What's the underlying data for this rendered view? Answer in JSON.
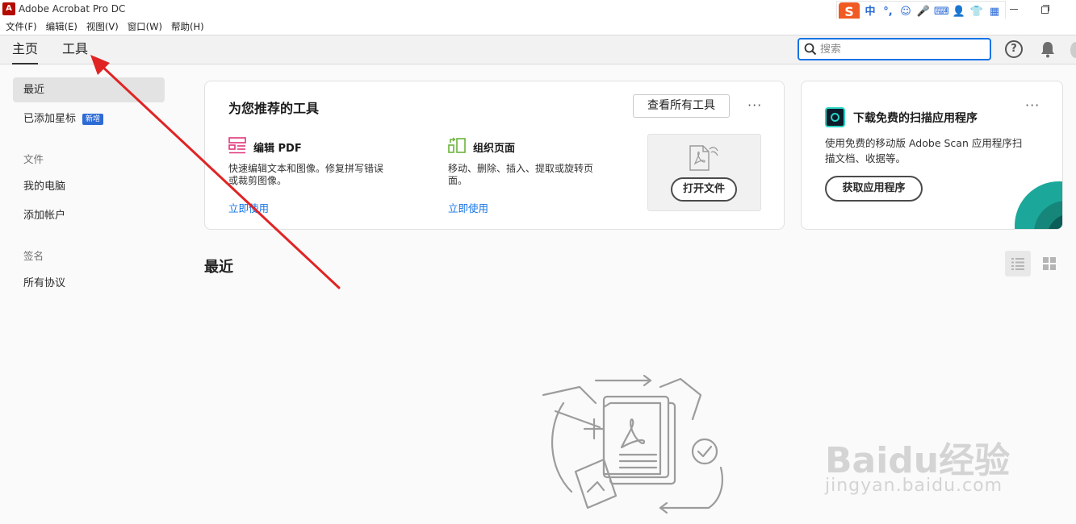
{
  "window": {
    "title": "Adobe Acrobat Pro DC"
  },
  "ime": {
    "logo": "S",
    "items": [
      "中",
      "°,",
      "☺",
      "🎤",
      "⌨",
      "👤",
      "👕",
      "▦"
    ]
  },
  "menubar": {
    "items": [
      "文件(F)",
      "编辑(E)",
      "视图(V)",
      "窗口(W)",
      "帮助(H)"
    ]
  },
  "nav": {
    "tabs": [
      "主页",
      "工具"
    ],
    "search_placeholder": "搜索"
  },
  "sidebar": {
    "recent": "最近",
    "starred": "已添加星标",
    "starred_badge": "新增",
    "files_section": "文件",
    "my_computer": "我的电脑",
    "add_account": "添加帐户",
    "sign_section": "签名",
    "all_agreements": "所有协议"
  },
  "recommended": {
    "title": "为您推荐的工具",
    "view_all": "查看所有工具",
    "more": "···",
    "tools": [
      {
        "name": "编辑 PDF",
        "desc_line1": "快速编辑文本和图像。修复拼写错误",
        "desc_line2": "或裁剪图像。",
        "link": "立即使用",
        "icon_color": "#e0357a"
      },
      {
        "name": "组织页面",
        "desc_line1": "移动、删除、插入、提取或旋转页",
        "desc_line2": "面。",
        "link": "立即使用",
        "icon_color": "#6bb33a"
      }
    ],
    "open_file": "打开文件"
  },
  "scan": {
    "title": "下载免费的扫描应用程序",
    "desc_line1": "使用免费的移动版 Adobe Scan 应用程序扫",
    "desc_line2": "描文档、收据等。",
    "button": "获取应用程序",
    "more": "···",
    "accent": "#1ba89a"
  },
  "recent_section": {
    "title": "最近"
  },
  "watermark": {
    "brand": "Baidu经验",
    "sub": "jingyan.baidu.com"
  },
  "annotation": {
    "arrow_color": "#e02424"
  }
}
